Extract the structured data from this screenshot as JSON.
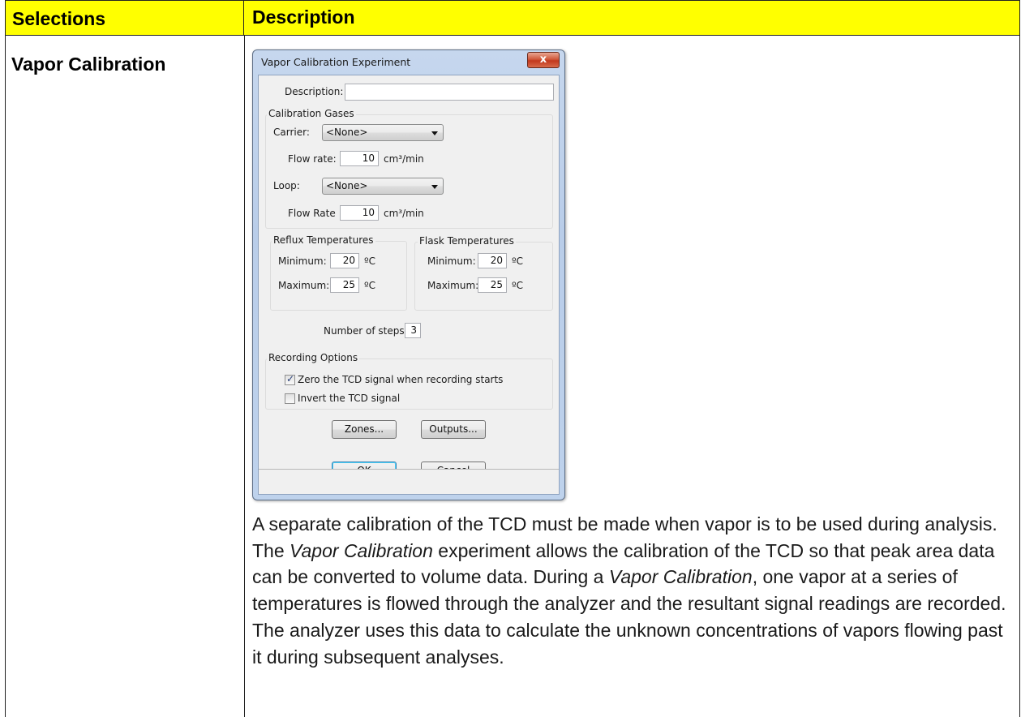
{
  "table": {
    "header_left": "Selections",
    "header_right": "Description",
    "row_label": "Vapor Calibration",
    "description": {
      "p1": "A separate calibration of the TCD must be made when vapor is to be used during analysis. The ",
      "i1": "Vapor Calibration",
      "p2": " experiment allows the calibration of the TCD so that peak area data can be converted to volume data. During a ",
      "i2": "Vapor Calibration",
      "p3": ", one vapor at a series of temperatures is flowed through the analyzer and the resultant signal readings are recorded. The analyzer uses this data to calculate the unknown concentrations of vapors flowing past it during subsequent analyses."
    }
  },
  "dialog": {
    "title": "Vapor Calibration Experiment",
    "close_glyph": "x",
    "description_label": "Description:",
    "description_value": "",
    "calibration_gases": {
      "title": "Calibration Gases",
      "carrier_label": "Carrier:",
      "carrier_value": "<None>",
      "carrier_flow_label": "Flow rate:",
      "carrier_flow_value": "10",
      "carrier_flow_unit": "cm³/min",
      "loop_label": "Loop:",
      "loop_value": "<None>",
      "loop_flow_label": "Flow Rate",
      "loop_flow_value": "10",
      "loop_flow_unit": "cm³/min"
    },
    "reflux": {
      "title": "Reflux Temperatures",
      "min_label": "Minimum:",
      "min_value": "20",
      "max_label": "Maximum:",
      "max_value": "25",
      "unit": "ºC"
    },
    "flask": {
      "title": "Flask Temperatures",
      "min_label": "Minimum:",
      "min_value": "20",
      "max_label": "Maximum:",
      "max_value": "25",
      "unit": "ºC"
    },
    "steps_label": "Number of steps:",
    "steps_value": "3",
    "recording": {
      "title": "Recording Options",
      "zero_label": "Zero the TCD signal when recording starts",
      "zero_checked": true,
      "invert_label": "Invert the TCD signal",
      "invert_checked": false
    },
    "buttons": {
      "zones": "Zones...",
      "outputs": "Outputs...",
      "ok": "OK",
      "cancel": "Cancel"
    }
  }
}
